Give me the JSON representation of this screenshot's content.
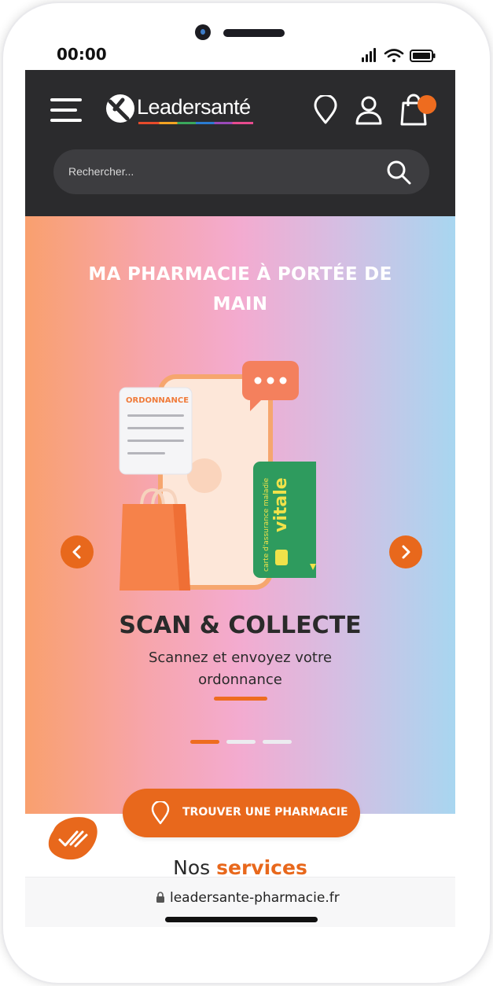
{
  "status_bar": {
    "time": "00:00"
  },
  "header": {
    "brand_name": "Leadersanté",
    "search": {
      "placeholder": "Rechercher...",
      "value": ""
    },
    "icons": [
      "menu-icon",
      "location-pin-icon",
      "user-icon",
      "shopping-bag-icon"
    ],
    "cart_badge_color": "#ee6c1f"
  },
  "hero": {
    "title": "MA PHARMACIE À PORTÉE DE MAIN",
    "slide": {
      "title": "SCAN & COLLECTE",
      "subtitle": "Scannez et envoyez votre ordonnance"
    },
    "illustration": {
      "prescription_label": "ORDONNANCE",
      "card_text_vertical": "carte d'assurance maladie",
      "card_brand": "vitale"
    },
    "carousel": {
      "dots": 3,
      "active_dot": 1
    }
  },
  "cta": {
    "label": "TROUVER UNE PHARMACIE"
  },
  "services": {
    "prefix": "Nos",
    "highlight": "services"
  },
  "browser": {
    "url": "leadersante-pharmacie.fr"
  },
  "colors": {
    "accent": "#e8681c",
    "header_bg": "#2b2b2d",
    "search_bg": "#3d3d40",
    "text_dark": "#2a2a2a"
  }
}
